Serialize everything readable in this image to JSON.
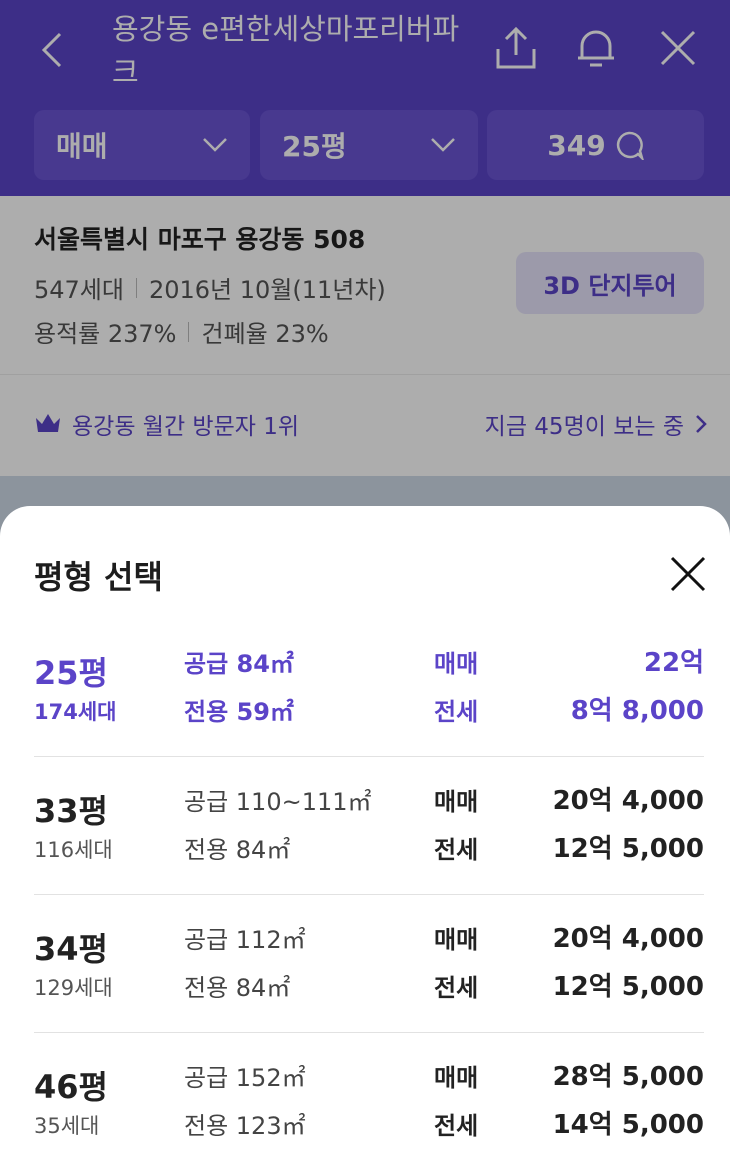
{
  "header": {
    "title": "용강동 e편한세상마포리버파크",
    "filters": {
      "trade": "매매",
      "size": "25평",
      "comments": "349"
    }
  },
  "info": {
    "address": "서울특별시 마포구 용강동 508",
    "households": "547세대",
    "built": "2016년 10월(11년차)",
    "far": "용적률 237%",
    "bcr": "건폐율 23%",
    "tour_button": "3D 단지투어"
  },
  "ranking": {
    "rank_text": "용강동 월간 방문자 1위",
    "viewers_text": "지금 45명이 보는 중"
  },
  "sheet": {
    "title": "평형 선택",
    "rows": [
      {
        "pyeong": "25평",
        "units": "174세대",
        "supply": "공급 84㎡",
        "exclusive": "전용 59㎡",
        "trade_label": "매매",
        "trade_price": "22억",
        "jeonse_label": "전세",
        "jeonse_price": "8억 8,000",
        "selected": true
      },
      {
        "pyeong": "33평",
        "units": "116세대",
        "supply": "공급 110~111㎡",
        "exclusive": "전용 84㎡",
        "trade_label": "매매",
        "trade_price": "20억 4,000",
        "jeonse_label": "전세",
        "jeonse_price": "12억 5,000"
      },
      {
        "pyeong": "34평",
        "units": "129세대",
        "supply": "공급 112㎡",
        "exclusive": "전용 84㎡",
        "trade_label": "매매",
        "trade_price": "20억 4,000",
        "jeonse_label": "전세",
        "jeonse_price": "12억 5,000"
      },
      {
        "pyeong": "46평",
        "units": "35세대",
        "supply": "공급 152㎡",
        "exclusive": "전용 123㎡",
        "trade_label": "매매",
        "trade_price": "28억 5,000",
        "jeonse_label": "전세",
        "jeonse_price": "14억 5,000"
      }
    ]
  },
  "colors": {
    "brand": "#5b44c8",
    "chip": "#6a55d3",
    "tour_bg": "#e6e3fb"
  }
}
